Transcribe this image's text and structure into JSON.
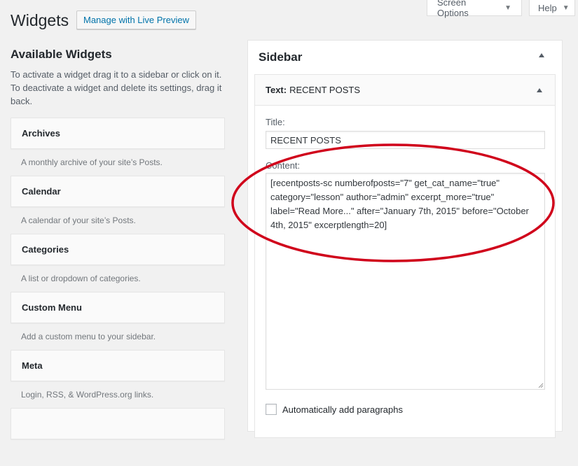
{
  "top_tabs": {
    "screen_options": "Screen Options",
    "help": "Help",
    "caret": "▼"
  },
  "header": {
    "title": "Widgets",
    "live_preview_button": "Manage with Live Preview"
  },
  "available": {
    "title": "Available Widgets",
    "description": "To activate a widget drag it to a sidebar or click on it. To deactivate a widget and delete its settings, drag it back.",
    "widgets": [
      {
        "name": "Archives",
        "description": "A monthly archive of your site’s Posts."
      },
      {
        "name": "Calendar",
        "description": "A calendar of your site’s Posts."
      },
      {
        "name": "Categories",
        "description": "A list or dropdown of categories."
      },
      {
        "name": "Custom Menu",
        "description": "Add a custom menu to your sidebar."
      },
      {
        "name": "Meta",
        "description": "Login, RSS, & WordPress.org links."
      }
    ]
  },
  "sidebar": {
    "title": "Sidebar",
    "widget": {
      "type_label": "Text:",
      "name": "RECENT POSTS",
      "title_label": "Title:",
      "title_value": "RECENT POSTS",
      "content_label": "Content:",
      "content_value": "[recentposts-sc numberofposts=\"7\" get_cat_name=\"true\" category=\"lesson\" author=\"admin\" excerpt_more=\"true\" label=\"Read More...\" after=\"January 7th, 2015\" before=\"October 4th, 2015\" excerptlength=20]",
      "auto_paragraphs_label": "Automatically add paragraphs",
      "auto_paragraphs_checked": false
    }
  },
  "annotation": {
    "color": "#d0021b"
  }
}
